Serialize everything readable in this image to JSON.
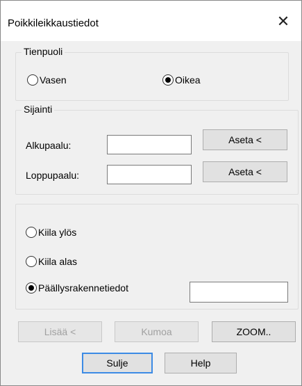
{
  "window": {
    "title": "Poikkileikkaustiedot"
  },
  "tienpuoli": {
    "label": "Tienpuoli",
    "options": [
      {
        "label": "Vasen",
        "selected": false
      },
      {
        "label": "Oikea",
        "selected": true
      }
    ]
  },
  "sijainti": {
    "label": "Sijainti",
    "start_label": "Alkupaalu:",
    "start_value": "",
    "end_label": "Loppupaalu:",
    "end_value": "",
    "set_label": "Aseta <"
  },
  "options": {
    "items": [
      {
        "label": "Kiila ylös",
        "selected": false
      },
      {
        "label": "Kiila alas",
        "selected": false
      },
      {
        "label": "Päällysrakennetiedot",
        "selected": true
      }
    ],
    "paallys_value": ""
  },
  "buttons": {
    "add": "Lisää <",
    "undo": "Kumoa",
    "zoom": "ZOOM..",
    "close": "Sulje",
    "help": "Help"
  },
  "icons": {
    "close": "close-icon"
  }
}
